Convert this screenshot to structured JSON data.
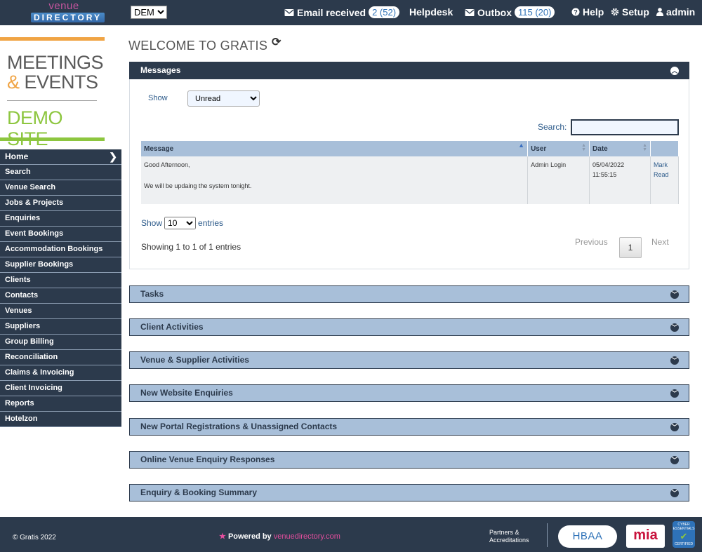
{
  "topbar": {
    "logo_line1": "venue",
    "logo_line2": "DIRECTORY",
    "site_select": "DEM",
    "email_label": "Email received",
    "email_badge": "2 (52)",
    "helpdesk_label": "Helpdesk",
    "outbox_label": "Outbox",
    "outbox_badge": "115 (20)",
    "help_label": "Help",
    "setup_label": "Setup",
    "user_label": "admin"
  },
  "brand": {
    "line1": "MEETINGS",
    "line2_amp": "&",
    "line2": " EVENTS",
    "line3": "DEMO SITE"
  },
  "sidebar": {
    "items": [
      {
        "label": "Home"
      },
      {
        "label": "Search"
      },
      {
        "label": "Venue Search"
      },
      {
        "label": "Jobs & Projects"
      },
      {
        "label": "Enquiries"
      },
      {
        "label": "Event Bookings"
      },
      {
        "label": "Accommodation Bookings"
      },
      {
        "label": "Supplier Bookings"
      },
      {
        "label": "Clients"
      },
      {
        "label": "Contacts"
      },
      {
        "label": "Venues"
      },
      {
        "label": "Suppliers"
      },
      {
        "label": "Group Billing"
      },
      {
        "label": "Reconciliation"
      },
      {
        "label": "Claims & Invoicing"
      },
      {
        "label": "Client Invoicing"
      },
      {
        "label": "Reports"
      },
      {
        "label": "Hotelzon"
      }
    ]
  },
  "main": {
    "title": "WELCOME TO GRATIS",
    "messages": {
      "heading": "Messages",
      "show_label": "Show",
      "filter_value": "Unread",
      "search_label": "Search:",
      "columns": [
        "Message",
        "User",
        "Date",
        ""
      ],
      "rows": [
        {
          "message_line1": "Good Afternoon,",
          "message_line2": "We will be updaing the system tonight.",
          "user": "Admin Login",
          "date_line1": "05/04/2022",
          "date_line2": "11:55:15",
          "action_line1": "Mark",
          "action_line2": "Read"
        }
      ],
      "length_show": "Show",
      "length_value": "10",
      "length_entries": "entries",
      "info": "Showing 1 to 1 of 1 entries",
      "previous": "Previous",
      "page": "1",
      "next": "Next"
    },
    "panels": [
      {
        "label": "Tasks"
      },
      {
        "label": "Client Activities"
      },
      {
        "label": "Venue & Supplier Activities"
      },
      {
        "label": "New Website Enquiries"
      },
      {
        "label": "New Portal Registrations & Unassigned Contacts"
      },
      {
        "label": "Online Venue Enquiry Responses"
      },
      {
        "label": "Enquiry & Booking Summary"
      }
    ]
  },
  "footer": {
    "copyright": "© Gratis 2022",
    "powered_by": "Powered by",
    "powered_site": "venuedirectory.com",
    "partners_line1": "Partners &",
    "partners_line2": "Accreditations",
    "hbaa": "HBAA",
    "mia": "mia",
    "cyber_line1": "CYBER",
    "cyber_line2": "ESSENTIALS",
    "cyber_line3": "CERTIFIED"
  },
  "colors": {
    "navy": "#2c3a4c",
    "panel_light": "#a8bfd9",
    "orange": "#f0a444",
    "green": "#8dc63f",
    "pink": "#e54e9e"
  }
}
